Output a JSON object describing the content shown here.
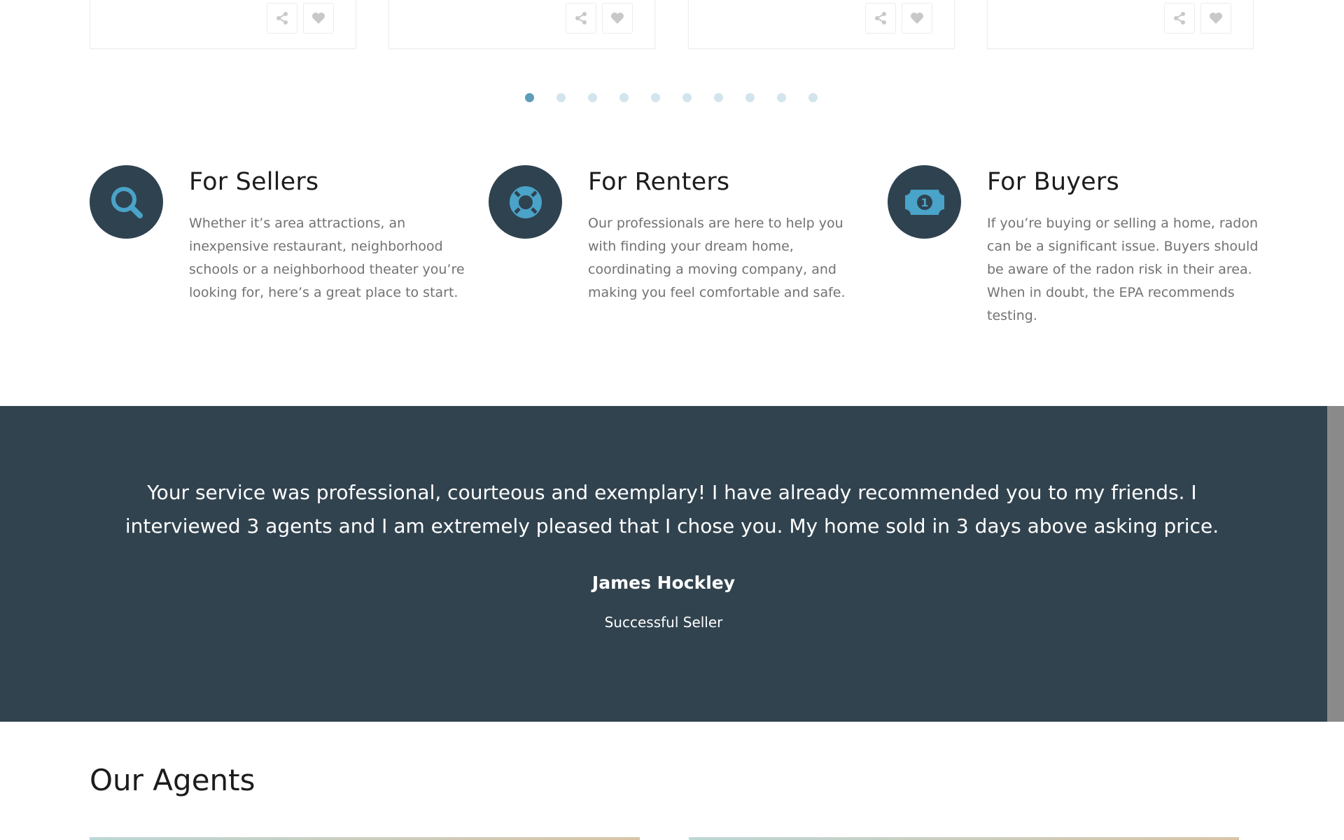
{
  "property_cards": {
    "count": 4,
    "actions": [
      {
        "icon": "share-icon"
      },
      {
        "icon": "heart-icon"
      }
    ]
  },
  "carousel": {
    "total_dots": 10,
    "active_index": 0
  },
  "features": [
    {
      "icon": "search-icon",
      "title": "For Sellers",
      "description": "Whether it’s area attractions, an inexpensive restaurant, neighborhood schools or a neighborhood theater you’re looking for, here’s a great place to start."
    },
    {
      "icon": "life-ring-icon",
      "title": "For Renters",
      "description": "Our professionals are here to help you with finding your dream home, coordinating a moving company, and making you feel comfortable and safe."
    },
    {
      "icon": "money-bill-icon",
      "title": "For Buyers",
      "description": "If you’re buying or selling a home, radon can be a significant issue. Buyers should be aware of the radon risk in their area. When in doubt, the EPA recommends testing."
    }
  ],
  "testimonial": {
    "quote": "Your service was professional, courteous and exemplary! I have already recommended you to my friends.  I interviewed 3 agents and I am extremely pleased that I chose you. My home sold in 3 days above asking price.",
    "author": "James Hockley",
    "role": "Successful Seller"
  },
  "agents": {
    "title": "Our Agents"
  },
  "colors": {
    "dark_band": "#31434f",
    "badge_bg": "#2f4250",
    "icon_accent": "#4aa3c8",
    "dot_active": "#5e9db9",
    "dot_inactive": "#d3e5ec",
    "body_text": "#727272"
  }
}
